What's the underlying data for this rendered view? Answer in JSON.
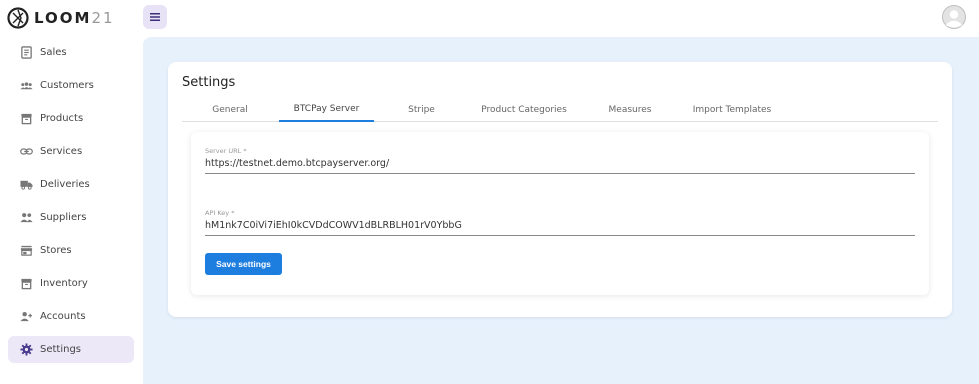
{
  "app": {
    "brand_text": "LOOM",
    "brand_number": "21"
  },
  "sidebar": {
    "items": [
      {
        "label": "Sales",
        "icon": "receipt-icon"
      },
      {
        "label": "Customers",
        "icon": "people-icon"
      },
      {
        "label": "Products",
        "icon": "archive-box-icon"
      },
      {
        "label": "Services",
        "icon": "link-icon"
      },
      {
        "label": "Deliveries",
        "icon": "truck-icon"
      },
      {
        "label": "Suppliers",
        "icon": "group-icon"
      },
      {
        "label": "Stores",
        "icon": "storefront-icon"
      },
      {
        "label": "Inventory",
        "icon": "archive-box-icon"
      },
      {
        "label": "Accounts",
        "icon": "add-user-icon"
      },
      {
        "label": "Settings",
        "icon": "gear-icon",
        "active": true
      }
    ]
  },
  "page": {
    "title": "Settings",
    "tabs": [
      {
        "label": "General"
      },
      {
        "label": "BTCPay Server",
        "active": true
      },
      {
        "label": "Stripe"
      },
      {
        "label": "Product Categories"
      },
      {
        "label": "Measures"
      },
      {
        "label": "Import Templates"
      }
    ]
  },
  "form": {
    "server_url": {
      "label": "Server URL *",
      "value": "https://testnet.demo.btcpayserver.org/"
    },
    "api_key": {
      "label": "API Key *",
      "value": "hM1nk7C0iVi7iEhI0kCVDdCOWV1dBLRBLH01rV0YbbG"
    },
    "save_label": "Save settings"
  },
  "colors": {
    "accent": "#1e7ee0",
    "main_background": "#e6f1fc",
    "active_nav_background": "#ede8f7",
    "menu_button_background": "#e8e2f6"
  }
}
